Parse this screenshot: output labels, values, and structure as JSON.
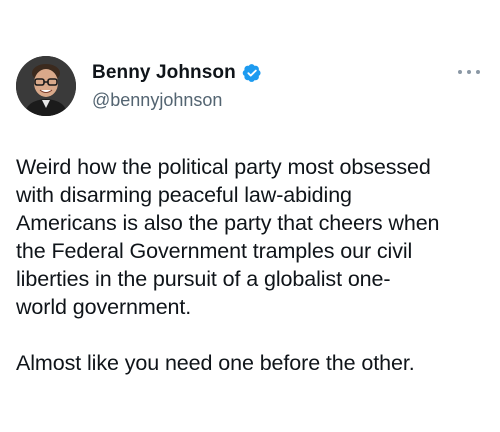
{
  "tweet": {
    "author": {
      "display_name": "Benny Johnson",
      "handle": "@bennyjohnson",
      "verified": true,
      "avatar_icon": "profile-photo"
    },
    "more_icon": "more-options-icon",
    "paragraphs": [
      "Weird how the political party most obsessed\nwith disarming peaceful law-abiding\nAmericans is also the party that cheers when\nthe Federal Government tramples our civil\nliberties in the pursuit of a globalist one-\nworld government.",
      "Almost like you need one before the other."
    ]
  },
  "colors": {
    "text": "#0f1419",
    "secondary": "#536471",
    "verified_blue": "#1d9bf0",
    "background": "#ffffff"
  }
}
